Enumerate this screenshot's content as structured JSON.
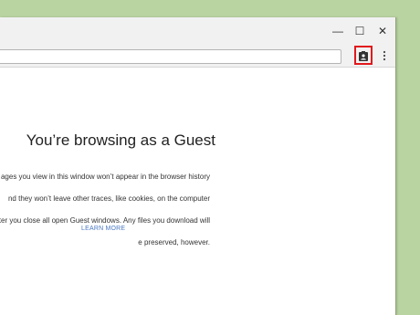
{
  "window": {
    "controls": {
      "minimize_glyph": "—",
      "maximize_glyph": "☐",
      "close_glyph": "✕"
    }
  },
  "toolbar": {
    "guest_profile_icon": "guest-profile-icon",
    "guest_highlight_color": "#e1181c",
    "menu_icon": "kebab-menu-icon"
  },
  "guest_page": {
    "heading": "You’re browsing as a Guest",
    "description_lines": [
      "ages you view in this window won’t appear in the browser history",
      "nd they won’t leave other traces, like cookies, on the computer",
      "ter you close all open Guest windows. Any files you download will",
      "e preserved, however."
    ],
    "learn_more": "LEARN MORE",
    "link_color": "#4a78c2"
  }
}
